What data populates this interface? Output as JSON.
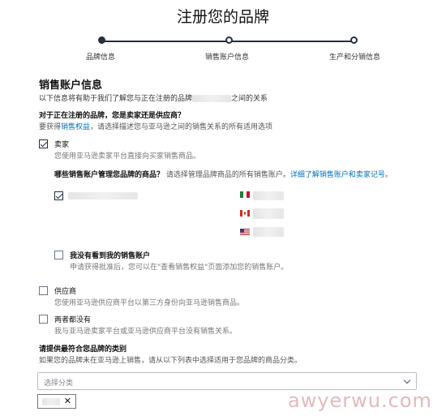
{
  "page": {
    "title": "注册您的品牌"
  },
  "steps": [
    {
      "label": "品牌信息",
      "state": "completed"
    },
    {
      "label": "销售账户信息",
      "state": "current"
    },
    {
      "label": "生产和分销信息",
      "state": "upcoming"
    }
  ],
  "section": {
    "heading": "销售账户信息",
    "intro_before": "以下信息将有助于我们了解您与正在注册的品牌",
    "intro_after": "之间的关系"
  },
  "q1": {
    "label": "对于正在注册的品牌，您是卖家还是供应商？",
    "help_before": "要获得",
    "help_link": "销售权益",
    "help_after": "，请选择描述您与亚马逊之间的销售关系的所有适用选项"
  },
  "option_seller": {
    "label": "卖家",
    "desc": "您使用亚马逊卖家平台直接向买家销售商品。",
    "checked": true
  },
  "accounts_q": {
    "label": "哪些销售账户管理您品牌的商品？",
    "help": "请选择管理品牌商品的所有销售账户。",
    "link": "详细了解销售账户和卖家记号。"
  },
  "account": {
    "checked": true
  },
  "marketplaces": [
    {
      "flag": "mexico-flag"
    },
    {
      "flag": "canada-flag"
    },
    {
      "flag": "usa-flag"
    }
  ],
  "no_account": {
    "label": "我没有看到我的销售账户",
    "desc": "申请获得批准后，您可以在\"查看销售权益\"页面添加您的销售账户。",
    "checked": false
  },
  "option_vendor": {
    "label": "供应商",
    "desc": "您使用亚马逊供应商平台以第三方身份向亚马逊销售商品。",
    "checked": false
  },
  "option_neither": {
    "label": "两者都没有",
    "desc": "我与亚马逊卖家平台或亚马逊供应商平台没有销售关系。",
    "checked": false
  },
  "category": {
    "label": "请提供最符合您品牌的类别",
    "help": "如果您的品牌未在亚马逊上销售，请从以下列表中选择适用于您品牌的商品分类。",
    "placeholder": "选择分类",
    "chip_close": "✕"
  },
  "watermark": "awyerwu.com",
  "colors": {
    "primary": "#232f3e",
    "link": "#0073bb",
    "watermark": "#e3b9be"
  }
}
